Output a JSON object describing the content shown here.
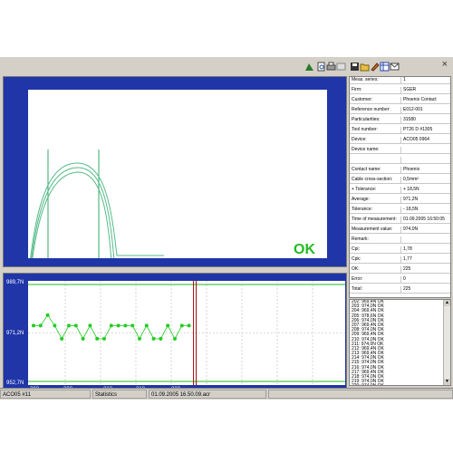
{
  "toolbar": {
    "icons": [
      "chart-icon",
      "print-preview-icon",
      "print-icon",
      "export-icon",
      "save-icon",
      "open-folder-icon",
      "edit-icon",
      "table-icon",
      "mail-icon"
    ],
    "close_label": "×"
  },
  "curve": {
    "ok_label": "OK"
  },
  "trend": {
    "y_ticks": [
      "989,7N",
      "971,2N",
      "952,7N"
    ],
    "x_ticks": [
      "203",
      "208",
      "213",
      "218",
      "223"
    ]
  },
  "chart_data": {
    "type": "line",
    "x": [
      203,
      204,
      205,
      206,
      207,
      208,
      209,
      210,
      211,
      212,
      213,
      214,
      215,
      216,
      217,
      218,
      219,
      220,
      221,
      222,
      223,
      224,
      225
    ],
    "values": [
      974,
      974,
      978,
      974,
      969,
      974,
      974,
      969,
      974,
      969,
      969,
      974,
      974,
      974,
      974,
      969,
      974,
      969,
      969,
      974,
      969,
      974,
      974
    ],
    "ylim": [
      952.7,
      989.7
    ],
    "y_ticks": [
      "989,7N",
      "971,2N",
      "952,7N"
    ],
    "x_ticks": [
      203,
      208,
      213,
      218,
      223
    ],
    "colors": {
      "line": "#22cc22",
      "limits": "#22bb22",
      "cursor": "#aa0000"
    }
  },
  "info": {
    "rows": [
      {
        "key": "Meas. series:",
        "value": "1"
      },
      {
        "key": "Firm:",
        "value": "SGER"
      },
      {
        "key": "Customer:",
        "value": "Phoenix Contact"
      },
      {
        "key": "Reference number:",
        "value": "E012-001"
      },
      {
        "key": "Particularities:",
        "value": "31580"
      },
      {
        "key": "Tool number:",
        "value": "PT26 D #1305"
      },
      {
        "key": "Device:",
        "value": "ACO05 0964"
      },
      {
        "key": "Device name:",
        "value": ""
      },
      {
        "key": "",
        "value": ""
      },
      {
        "key": "Contact name:",
        "value": "Phoenix"
      },
      {
        "key": "Cable cross-section:",
        "value": "0,5mm²"
      },
      {
        "key": "+ Tolerance:",
        "value": "+ 18,5N"
      },
      {
        "key": "Average:",
        "value": "971,2N"
      },
      {
        "key": " Tolerance:",
        "value": "- 18,5N"
      },
      {
        "key": "Time of measurement:",
        "value": "01.09.2005 16:50:05"
      },
      {
        "key": "Measurement value:",
        "value": "974,0N"
      },
      {
        "key": "Remark:",
        "value": ""
      },
      {
        "key": "Cpi:",
        "value": "1,78"
      },
      {
        "key": "Cpk:",
        "value": "1,77"
      },
      {
        "key": "OK:",
        "value": "225"
      },
      {
        "key": "Error:",
        "value": "0"
      },
      {
        "key": "Total:",
        "value": "225"
      }
    ]
  },
  "log": {
    "items": [
      "202: 969,4N OK",
      "203: 974,0N OK",
      "204: 969,4N OK",
      "205: 978,6N OK",
      "206: 974,0N OK",
      "207: 969,4N OK",
      "208: 974,0N OK",
      "209: 969,4N OK",
      "210: 974,0N OK",
      "211: 974,0N OK",
      "212: 969,4N OK",
      "213: 969,4N OK",
      "214: 974,0N OK",
      "215: 974,0N OK",
      "216: 974,0N OK",
      "217: 969,4N OK",
      "218: 974,0N OK",
      "219: 974,0N OK",
      "220: 974,0N OK",
      "221: 969,4N OK",
      "222: 969,4N OK",
      "223: 974,0N OK",
      "224: 974,0N OK",
      "225: 974,0N OK"
    ],
    "selected_index": 23
  },
  "status": {
    "device": "ACO05 #11",
    "mode": "Statistics",
    "file": "01.09.2005 16.50.09.acr"
  }
}
